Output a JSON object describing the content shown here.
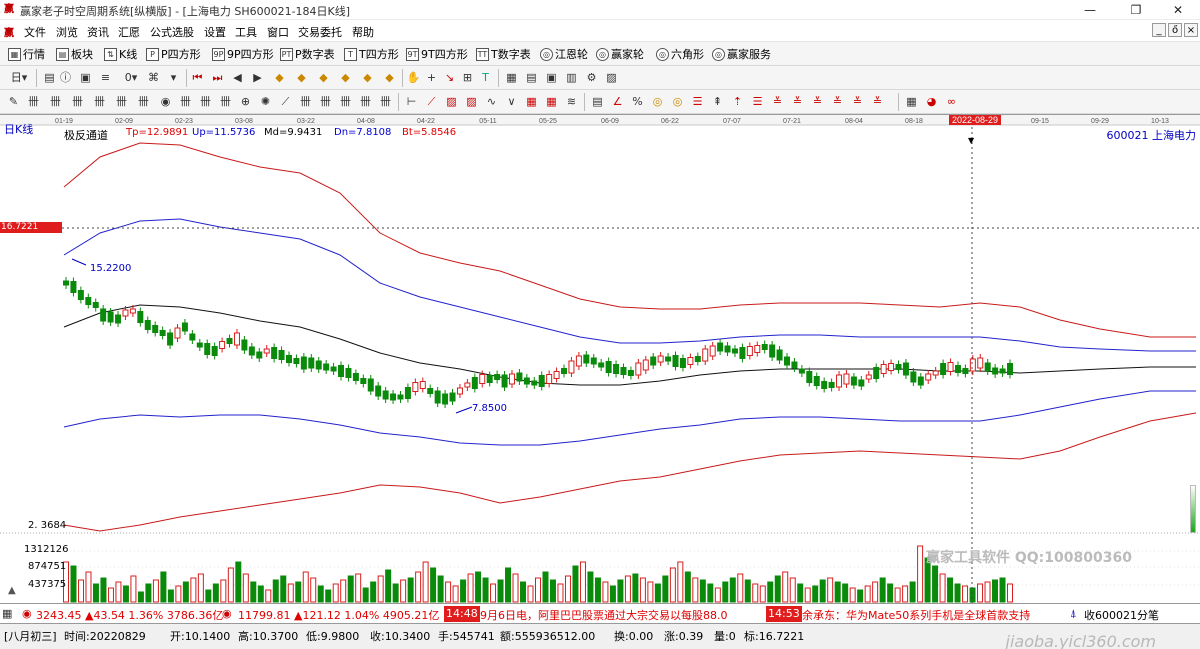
{
  "window": {
    "title": "赢家老子时空周期系统[纵横版] - [上海电力  SH600021-184日K线]",
    "app_icon": "赢",
    "minimize": "—",
    "maximize": "❐",
    "close": "✕"
  },
  "menu": [
    "文件",
    "浏览",
    "资讯",
    "汇愿",
    "公式选股",
    "设置",
    "工具",
    "窗口",
    "交易委托",
    "帮助"
  ],
  "mdi_controls": [
    "_",
    "ő",
    "×"
  ],
  "toolbar1": [
    "行情",
    "板块",
    "K线",
    "P四方形",
    "9P四方形",
    "P数字表",
    "T四方形",
    "9T四方形",
    "T数字表",
    "江恩轮",
    "赢家轮",
    "六角形",
    "赢家服务"
  ],
  "toolbar1_icons": [
    "▦",
    "▤",
    "⇅",
    "P",
    "9P",
    "PT",
    "T",
    "9T",
    "TT",
    "◎",
    "◎",
    "◎",
    "◎"
  ],
  "chart": {
    "period_label": "日K线",
    "indicator_name": "极反通道",
    "params": [
      {
        "label": "Tp=12.9891",
        "color": "#e00000"
      },
      {
        "label": "Up=11.5736",
        "color": "#0000d0"
      },
      {
        "label": "Md=9.9431",
        "color": "#000000"
      },
      {
        "label": "Dn=7.8108",
        "color": "#0000d0"
      },
      {
        "label": "Bt=5.8546",
        "color": "#e00000"
      }
    ],
    "stock_label": "600021  上海电力",
    "dates": [
      "01-19",
      "02-09",
      "02-23",
      "03-08",
      "03-22",
      "04-08",
      "04-22",
      "05-11",
      "05-25",
      "06-09",
      "06-22",
      "07-07",
      "07-21",
      "08-04",
      "08-18",
      "2022-08-29",
      "09-15",
      "09-29",
      "10-13"
    ],
    "crosshair_price": "16.7221",
    "high_label": "15.2200",
    "low_label": "7.8500",
    "bottom_label": "2. 3684",
    "volume_labels": [
      "1312126",
      "874751",
      "437375"
    ],
    "volume_axis_caret": "▲",
    "watermark": "赢家工具软件  QQ:100800360",
    "colors": {
      "up": "#d81e1e",
      "down": "#0a8a0a",
      "tp": "#c81a1a",
      "up_band": "#2222cc",
      "md": "#111111"
    }
  },
  "ticker": {
    "sh_index": "3243.45 ▲43.54 1.36% 3786.36亿",
    "sz_index": "11799.81 ▲121.12 1.04% 4905.21亿",
    "news1_time": "14:48",
    "news1_text": "9月6日电，阿里巴巴股票通过大宗交易以每股88.0",
    "news2_time": "14:53",
    "news2_text": "余承东：华为Mate50系列手机是全球首款支持",
    "right_text": "收600021分笔"
  },
  "status": {
    "lunar": "[八月初三]",
    "time": "时间:20220829",
    "open": "开:10.1400",
    "high": "高:10.3700",
    "low": "低:9.9800",
    "close": "收:10.3400",
    "volume": "手:545741",
    "amount": "额:555936512.00",
    "turnover": "换:0.00",
    "change": "涨:0.39",
    "quantity": "量:0",
    "marker": "标:16.7221",
    "watermark": "jiaoba.yicl360.com"
  }
}
